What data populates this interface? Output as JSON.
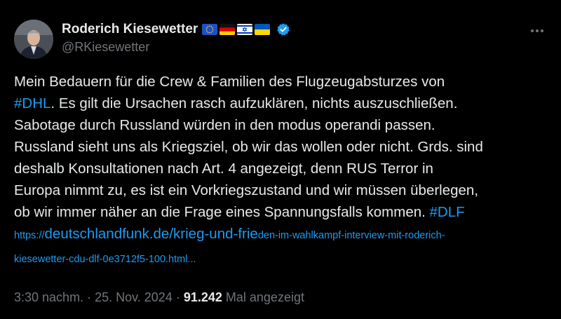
{
  "author": {
    "display_name": "Roderich Kiesewetter",
    "handle": "@RKiesewetter",
    "flags": [
      "eu-flag-icon",
      "germany-flag-icon",
      "israel-flag-icon",
      "ukraine-flag-icon"
    ],
    "verified": true
  },
  "tweet": {
    "line1": "Mein Bedauern für die Crew & Familien des Flugzeugabsturzes von",
    "hashtag1": "#DHL",
    "line2_rest": ". Es gilt die Ursachen rasch aufzuklären, nichts auszuschließen.",
    "line3": "Sabotage durch Russland würden in den modus operandi passen.",
    "line4": "Russland sieht uns als Kriegsziel, ob wir das wollen oder nicht. Grds. sind",
    "line5": "deshalb Konsultationen nach Art. 4 angezeigt, denn RUS Terror in",
    "line6": "Europa nimmt zu, es ist ein Vorkriegszustand und wir müssen überlegen,",
    "line7": "ob wir immer näher an die Frage eines Spannungsfalls kommen.",
    "hashtag2": "#DLF",
    "link": {
      "prefix": "https://",
      "domain_path": "deutschlandfunk.de/krieg-und-frie",
      "rest1": "den-im-wahlkampf-interview-mit-roderich-",
      "rest2": "kiesewetter-cdu-dlf-0e3712f5-100.html..."
    }
  },
  "meta": {
    "time": "3:30 nachm.",
    "date": "25. Nov. 2024",
    "views": "91.242",
    "views_label": "Mal angezeigt"
  },
  "colors": {
    "background": "#000000",
    "text": "#e7e9ea",
    "secondary": "#71767b",
    "accent": "#1d9bf0"
  }
}
